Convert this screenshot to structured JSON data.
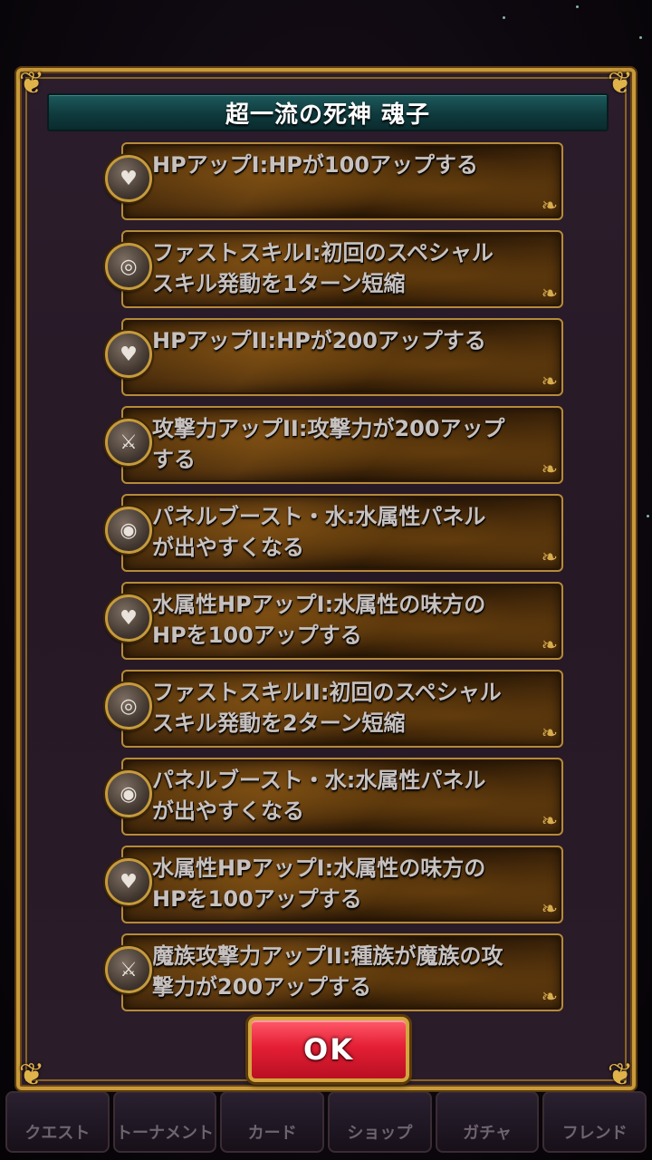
{
  "dialog": {
    "title": "超一流の死神 魂子",
    "ok_label": "OK"
  },
  "skills": [
    {
      "icon": "heart-icon",
      "text": "HPアップI:HPが100アップする"
    },
    {
      "icon": "target-icon",
      "text": "ファストスキルI:初回のスペシャル\nスキル発動を1ターン短縮"
    },
    {
      "icon": "heart-icon",
      "text": "HPアップII:HPが200アップする"
    },
    {
      "icon": "sword-icon",
      "text": "攻撃力アップII:攻撃力が200アップ\nする"
    },
    {
      "icon": "swirl-icon",
      "text": "パネルブースト・水:水属性パネル\nが出やすくなる"
    },
    {
      "icon": "heart-icon",
      "text": "水属性HPアップI:水属性の味方の\nHPを100アップする"
    },
    {
      "icon": "target-icon",
      "text": "ファストスキルII:初回のスペシャル\nスキル発動を2ターン短縮"
    },
    {
      "icon": "swirl-icon",
      "text": "パネルブースト・水:水属性パネル\nが出やすくなる"
    },
    {
      "icon": "heart-icon",
      "text": "水属性HPアップI:水属性の味方の\nHPを100アップする"
    },
    {
      "icon": "sword-icon",
      "text": "魔族攻撃力アップII:種族が魔族の攻\n撃力が200アップする"
    }
  ],
  "bottom_nav": [
    "クエスト",
    "トーナメント",
    "カード",
    "ショップ",
    "ガチャ",
    "フレンド"
  ]
}
